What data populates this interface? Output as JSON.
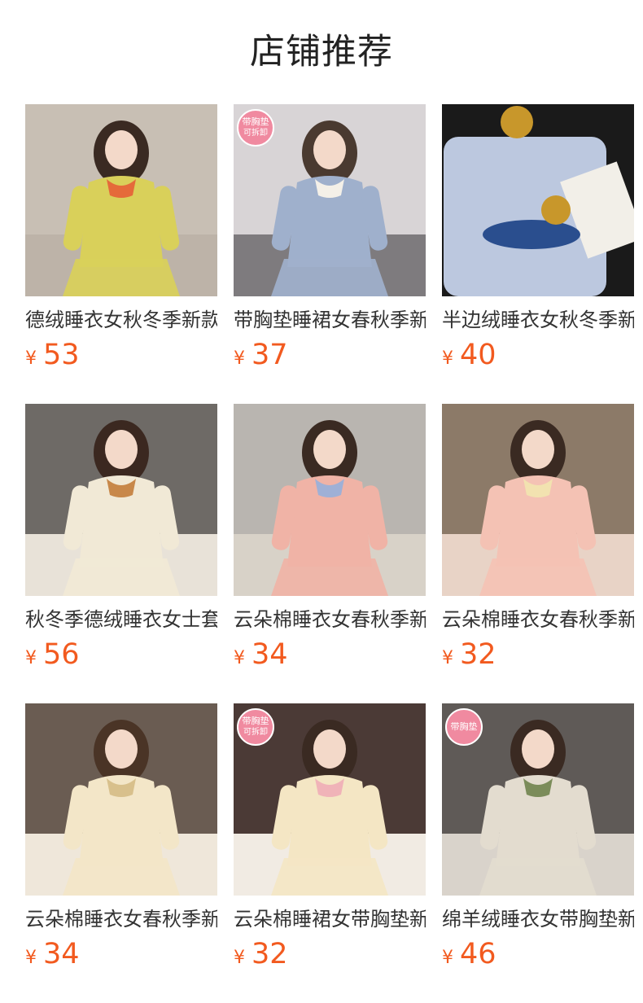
{
  "page": {
    "title": "店铺推荐"
  },
  "currency": "¥",
  "products": [
    {
      "title": "德绒睡衣女秋冬季新款",
      "price": "53",
      "badge": null,
      "badge2": null
    },
    {
      "title": "带胸垫睡裙女春秋季新款",
      "price": "37",
      "badge": "带胸垫",
      "badge2": "可拆卸"
    },
    {
      "title": "半边绒睡衣女秋冬季新款",
      "price": "40",
      "badge": null,
      "badge2": null
    },
    {
      "title": "秋冬季德绒睡衣女士套装",
      "price": "56",
      "badge": null,
      "badge2": null
    },
    {
      "title": "云朵棉睡衣女春秋季新款",
      "price": "34",
      "badge": null,
      "badge2": null
    },
    {
      "title": "云朵棉睡衣女春秋季新款",
      "price": "32",
      "badge": null,
      "badge2": null
    },
    {
      "title": "云朵棉睡衣女春秋季新款",
      "price": "34",
      "badge": null,
      "badge2": null
    },
    {
      "title": "云朵棉睡裙女带胸垫新款",
      "price": "32",
      "badge": "带胸垫",
      "badge2": "可拆卸"
    },
    {
      "title": "绵羊绒睡衣女带胸垫新款",
      "price": "46",
      "badge": "带胸垫",
      "badge2": null
    }
  ],
  "image_palettes": [
    {
      "bg": "#c8bfb4",
      "floor": "#bdb3a8",
      "outfit": "#d9d05a",
      "hair": "#3a2a22",
      "accent": "#e56a3a"
    },
    {
      "bg": "#d8d4d6",
      "floor": "#7e7b7e",
      "outfit": "#9fb0cc",
      "hair": "#4a3a30",
      "accent": "#f4f0e8"
    },
    {
      "bg": "#1a1a1a",
      "floor": "#2a2a2a",
      "outfit": "#bcc8df",
      "hair": "#c8972b",
      "accent": "#2a4e8e"
    },
    {
      "bg": "#6e6a66",
      "floor": "#e8e2d8",
      "outfit": "#f1e9d6",
      "hair": "#3b2820",
      "accent": "#c8884a"
    },
    {
      "bg": "#b9b5b0",
      "floor": "#d8d2c8",
      "outfit": "#f0b3a6",
      "hair": "#3a2a22",
      "accent": "#9fb0d6"
    },
    {
      "bg": "#8c7a68",
      "floor": "#e8d3c6",
      "outfit": "#f4c2b4",
      "hair": "#3a2a22",
      "accent": "#f2e2b0"
    },
    {
      "bg": "#6a5c52",
      "floor": "#efe7da",
      "outfit": "#f3e6c8",
      "hair": "#4a3426",
      "accent": "#d8c08c"
    },
    {
      "bg": "#4b3a36",
      "floor": "#f1ebe3",
      "outfit": "#f4e6c4",
      "hair": "#3a2a22",
      "accent": "#f0b3b8"
    },
    {
      "bg": "#5f5a57",
      "floor": "#d9d3cb",
      "outfit": "#e3dccf",
      "hair": "#3a2a22",
      "accent": "#7b8c5a"
    }
  ]
}
